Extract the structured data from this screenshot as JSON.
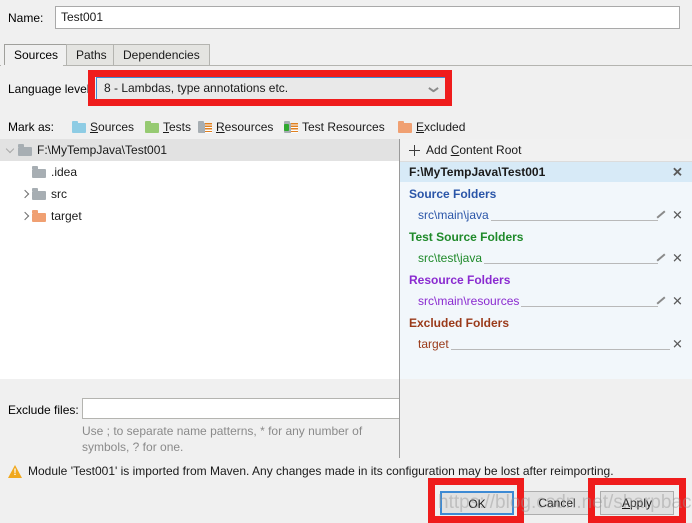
{
  "name_row": {
    "label": "Name:",
    "value": "Test001",
    "placeholder": ""
  },
  "tabs": [
    {
      "label": "Sources",
      "selected": true
    },
    {
      "label": "Paths",
      "selected": false
    },
    {
      "label": "Dependencies",
      "selected": false
    }
  ],
  "language_level": {
    "label": "Language level",
    "selected": "8 - Lambdas, type annotations etc.",
    "arrow_icon": "chevron-down-icon"
  },
  "mark_as": {
    "label": "Mark as:",
    "items": [
      {
        "label": "Sources",
        "mnemonic": "S",
        "icon": "folder-blue-icon"
      },
      {
        "label": "Tests",
        "mnemonic": "T",
        "icon": "folder-green-icon"
      },
      {
        "label": "Resources",
        "mnemonic": "R",
        "icon": "folder-resources-icon"
      },
      {
        "label": "Test Resources",
        "mnemonic": "",
        "icon": "folder-test-resources-icon"
      },
      {
        "label": "Excluded",
        "mnemonic": "E",
        "icon": "folder-orange-icon"
      }
    ]
  },
  "tree": [
    {
      "label": "F:\\MyTempJava\\Test001",
      "arrow": "down",
      "icon": "folder-gray-icon",
      "indent": 0,
      "selected": true
    },
    {
      "label": ".idea",
      "arrow": "none",
      "icon": "folder-gray-icon",
      "indent": 1,
      "selected": false
    },
    {
      "label": "src",
      "arrow": "right",
      "icon": "folder-gray-icon",
      "indent": 1,
      "selected": false
    },
    {
      "label": "target",
      "arrow": "right",
      "icon": "folder-orange-icon",
      "indent": 1,
      "selected": false
    }
  ],
  "content_root": {
    "add_label_pre": "Add ",
    "add_label_mnemonic": "C",
    "add_label_post": "ontent Root",
    "add_icon": "plus-icon",
    "root_path": "F:\\MyTempJava\\Test001",
    "remove_icon": "close-icon",
    "edit_icon": "pencil-icon",
    "groups": [
      {
        "title": "Source Folders",
        "color": "#2a55a8",
        "entries": [
          {
            "path": "src\\main\\java",
            "has_edit": true
          }
        ]
      },
      {
        "title": "Test Source Folders",
        "color": "#1f8a2a",
        "entries": [
          {
            "path": "src\\test\\java",
            "has_edit": true
          }
        ]
      },
      {
        "title": "Resource Folders",
        "color": "#8a2ad0",
        "entries": [
          {
            "path": "src\\main\\resources",
            "has_edit": true
          }
        ]
      },
      {
        "title": "Excluded Folders",
        "color": "#9a3a1a",
        "entries": [
          {
            "path": "target",
            "has_edit": false
          }
        ]
      }
    ]
  },
  "exclude_files": {
    "label": "Exclude files:",
    "value": "",
    "placeholder": "",
    "hint": "Use ; to separate name patterns, * for any number of symbols, ? for one."
  },
  "warning": {
    "icon": "warning-icon",
    "text": "Module 'Test001' is imported from Maven. Any changes made in its configuration may be lost after reimporting."
  },
  "buttons": {
    "ok": "OK",
    "cancel": "Cancel",
    "apply_pre": "",
    "apply_mnemonic": "A",
    "apply_post": "pply",
    "apply": "Apply"
  },
  "watermark": {
    "text": "https://blog.csdn.net/sharpback"
  },
  "annotations": {
    "color": "#ef1c1c",
    "boxes": [
      "language-level-combo",
      "ok-button",
      "apply-button"
    ]
  }
}
